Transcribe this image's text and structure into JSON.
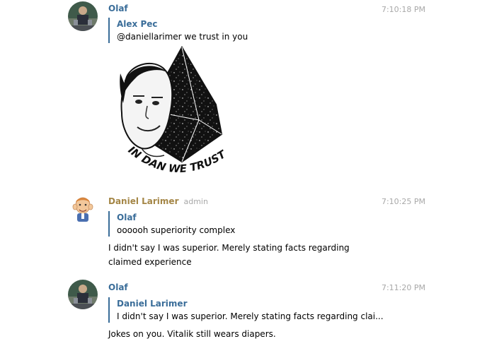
{
  "messages": [
    {
      "sender": "Olaf",
      "time": "7:10:18 PM",
      "reply_to": {
        "name": "Alex Pec",
        "text": "@daniellarimer we trust in you"
      },
      "image_caption": "IN DAN WE TRUST"
    },
    {
      "sender": "Daniel Larimer",
      "role": "admin",
      "time": "7:10:25 PM",
      "reply_to": {
        "name": "Olaf",
        "text": "oooooh superiority complex"
      },
      "text": "I didn't say I was superior. Merely stating facts regarding claimed experience"
    },
    {
      "sender": "Olaf",
      "time": "7:11:20 PM",
      "reply_to": {
        "name": "Daniel Larimer",
        "text": "I didn't say I was superior. Merely stating facts regarding clai..."
      },
      "text": "Jokes on you. Vitalik still wears diapers."
    }
  ],
  "colors": {
    "link_blue": "#3a6d99",
    "admin_gold": "#a48646",
    "meta_gray": "#a8a8a8"
  }
}
